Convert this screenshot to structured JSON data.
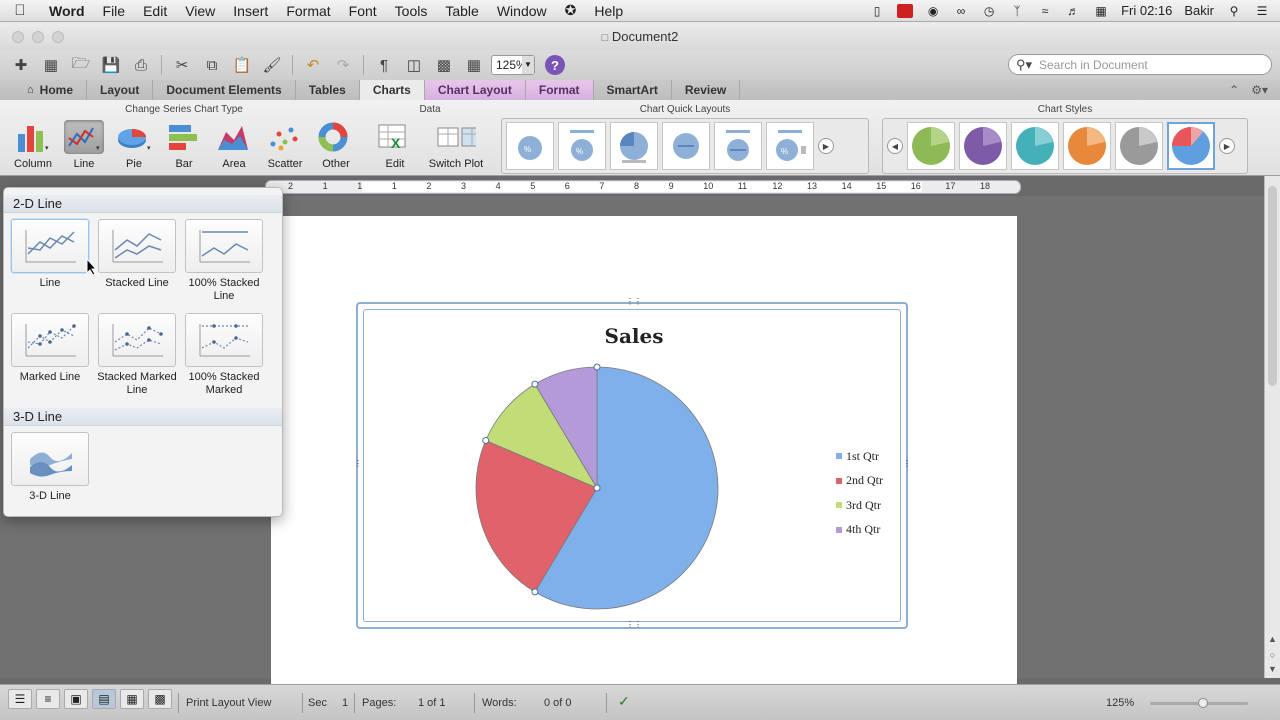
{
  "menubar": {
    "app": "Word",
    "items": [
      "File",
      "Edit",
      "View",
      "Insert",
      "Format",
      "Font",
      "Tools",
      "Table",
      "Window",
      "Help"
    ],
    "clock": "Fri 02:16",
    "user": "Bakir"
  },
  "window": {
    "title": "Document2"
  },
  "toolbar": {
    "zoom": "125%",
    "search_placeholder": "Search in Document"
  },
  "tabs": [
    "Home",
    "Layout",
    "Document Elements",
    "Tables",
    "Charts",
    "Chart Layout",
    "Format",
    "SmartArt",
    "Review"
  ],
  "ribbon": {
    "group_change_type": "Change Series Chart Type",
    "group_data": "Data",
    "group_quick_layouts": "Chart Quick Layouts",
    "group_styles": "Chart Styles",
    "chart_types": [
      "Column",
      "Line",
      "Pie",
      "Bar",
      "Area",
      "Scatter",
      "Other"
    ],
    "data_buttons": [
      "Edit",
      "Switch Plot"
    ],
    "style_colors": [
      "#8db956",
      "#7d5ba6",
      "#44b0b8",
      "#e8883a",
      "#9a9a9a",
      "#e8565a"
    ]
  },
  "ruler": {
    "numbers": [
      "2",
      "1",
      "1",
      "1",
      "2",
      "3",
      "4",
      "5",
      "6",
      "7",
      "8",
      "9",
      "10",
      "11",
      "12",
      "13",
      "14",
      "15",
      "16",
      "17",
      "18"
    ]
  },
  "dropdown": {
    "section_2d": "2-D Line",
    "section_3d": "3-D Line",
    "items_2d": [
      "Line",
      "Stacked Line",
      "100% Stacked Line",
      "Marked Line",
      "Stacked Marked Line",
      "100% Stacked Marked"
    ],
    "items_3d": [
      "3-D Line"
    ]
  },
  "chart_data": {
    "type": "pie",
    "title": "Sales",
    "categories": [
      "1st Qtr",
      "2nd Qtr",
      "3rd Qtr",
      "4th Qtr"
    ],
    "values": [
      8.2,
      3.2,
      1.4,
      1.2
    ],
    "colors": [
      "#7fb0ea",
      "#e0626a",
      "#c2dc78",
      "#b49ad8"
    ],
    "legend": "right"
  },
  "status": {
    "view": "Print Layout View",
    "sec_label": "Sec",
    "sec": "1",
    "pages_label": "Pages:",
    "pages": "1 of 1",
    "words_label": "Words:",
    "words": "0 of 0",
    "zoom": "125%"
  }
}
